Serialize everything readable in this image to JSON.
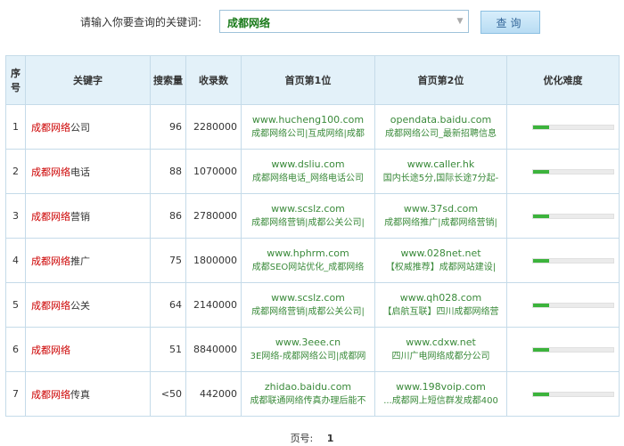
{
  "search": {
    "label": "请输入你要查询的关键词:",
    "value": "成都网络",
    "button": "查询"
  },
  "table": {
    "headers": {
      "num": "序号",
      "keyword": "关键字",
      "volume": "搜索量",
      "count": "收录数",
      "pos1": "首页第1位",
      "pos2": "首页第2位",
      "difficulty": "优化难度"
    },
    "rows": [
      {
        "num": "1",
        "kw_hl": "成都网络",
        "kw_rest": "公司",
        "volume": "96",
        "count": "2280000",
        "pos1_url": "www.hucheng100.com",
        "pos1_desc": "成都网络公司|互成网络|成都",
        "pos2_url": "opendata.baidu.com",
        "pos2_desc": "成都网络公司_最新招聘信息",
        "difficulty": 0.2
      },
      {
        "num": "2",
        "kw_hl": "成都网络",
        "kw_rest": "电话",
        "volume": "88",
        "count": "1070000",
        "pos1_url": "www.dsliu.com",
        "pos1_desc": "成都网络电话_网络电话公司",
        "pos2_url": "www.caller.hk",
        "pos2_desc": "国内长途5分,国际长途7分起-",
        "difficulty": 0.2
      },
      {
        "num": "3",
        "kw_hl": "成都网络",
        "kw_rest": "营销",
        "volume": "86",
        "count": "2780000",
        "pos1_url": "www.scslz.com",
        "pos1_desc": "成都网络营销|成都公关公司|",
        "pos2_url": "www.37sd.com",
        "pos2_desc": "成都网络推广|成都网络营销|",
        "difficulty": 0.2
      },
      {
        "num": "4",
        "kw_hl": "成都网络",
        "kw_rest": "推广",
        "volume": "75",
        "count": "1800000",
        "pos1_url": "www.hphrm.com",
        "pos1_desc": "成都SEO网站优化_成都网络",
        "pos2_url": "www.028net.net",
        "pos2_desc": "【权威推荐】成都网站建设|",
        "difficulty": 0.2
      },
      {
        "num": "5",
        "kw_hl": "成都网络",
        "kw_rest": "公关",
        "volume": "64",
        "count": "2140000",
        "pos1_url": "www.scslz.com",
        "pos1_desc": "成都网络营销|成都公关公司|",
        "pos2_url": "www.qh028.com",
        "pos2_desc": "【启航互联】四川成都网络营",
        "difficulty": 0.2
      },
      {
        "num": "6",
        "kw_hl": "成都网络",
        "kw_rest": "",
        "volume": "51",
        "count": "8840000",
        "pos1_url": "www.3eee.cn",
        "pos1_desc": "3E网络-成都网络公司|成都网",
        "pos2_url": "www.cdxw.net",
        "pos2_desc": "四川广电网络成都分公司",
        "difficulty": 0.2
      },
      {
        "num": "7",
        "kw_hl": "成都网络",
        "kw_rest": "传真",
        "volume": "<50",
        "count": "442000",
        "pos1_url": "zhidao.baidu.com",
        "pos1_desc": "成都联通网络传真办理后能不",
        "pos2_url": "www.198voip.com",
        "pos2_desc": "...成都网上短信群发成都400",
        "difficulty": 0.2
      }
    ]
  },
  "pager": {
    "label": "页号:",
    "page": "1"
  }
}
